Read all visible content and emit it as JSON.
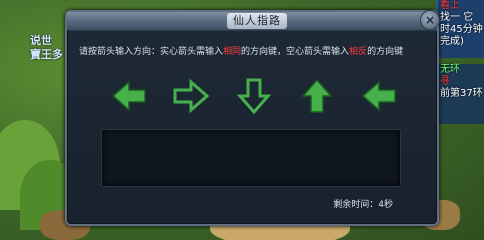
{
  "dialog": {
    "title": "仙人指路",
    "close_icon": "close-icon",
    "instruction_parts": [
      {
        "text": "请按箭头输入方向：实心箭头需输入",
        "color": "#d9e2ec"
      },
      {
        "text": "相同",
        "color": "#ff3b3b"
      },
      {
        "text": "的方向键，空心箭头需输入",
        "color": "#d9e2ec"
      },
      {
        "text": "相反",
        "color": "#ff3b3b"
      },
      {
        "text": "的方向键",
        "color": "#d9e2ec"
      }
    ],
    "arrows": [
      {
        "direction": "left",
        "style": "solid"
      },
      {
        "direction": "right",
        "style": "hollow"
      },
      {
        "direction": "down",
        "style": "hollow"
      },
      {
        "direction": "up",
        "style": "solid"
      },
      {
        "direction": "left",
        "style": "solid"
      }
    ],
    "timer_label": "剩余时间：",
    "timer_value": "4秒"
  },
  "left_overlay": {
    "line1": "说世",
    "line2": "寶王多"
  },
  "right_panel": {
    "b1_lines": [
      "看上",
      "找一 它",
      "时45分钟",
      "完成)"
    ],
    "b2_lines": [
      "无环",
      "寻",
      "前第37环"
    ]
  }
}
